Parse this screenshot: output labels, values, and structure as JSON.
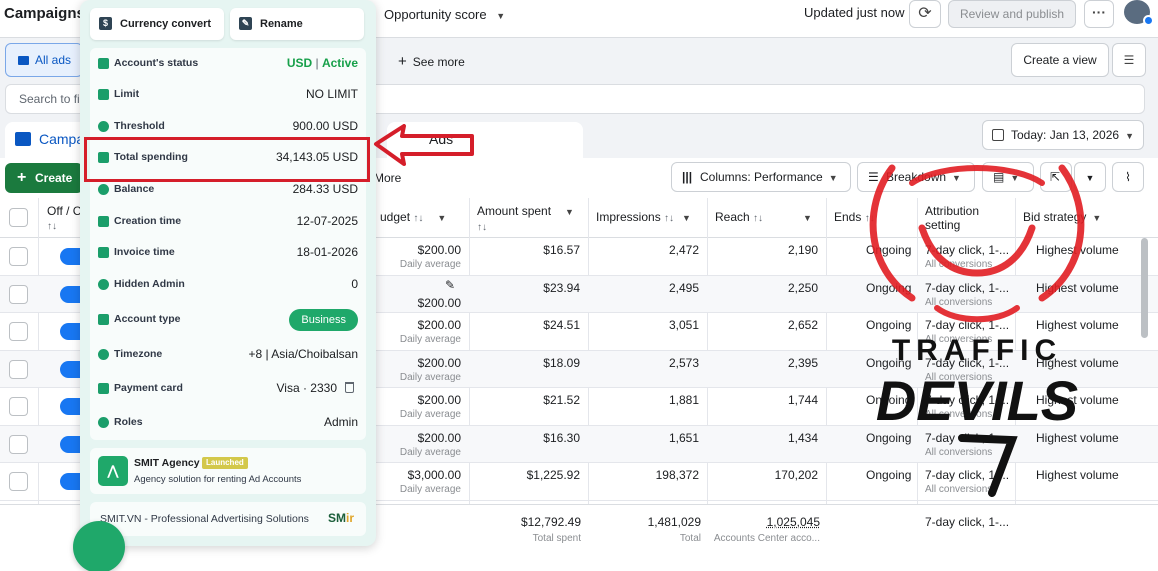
{
  "topbar": {
    "title": "Campaigns",
    "opportunity": "Opportunity score",
    "updated": "Updated just now",
    "review": "Review and publish",
    "more": "···"
  },
  "row2": {
    "all_ads": "All ads",
    "see_more": "See more",
    "create_view": "Create a view"
  },
  "search": {
    "placeholder": "Search to fil"
  },
  "tabs": {
    "campaigns": "Campa",
    "ads": "Ads"
  },
  "date": "Today: Jan 13, 2026",
  "toolbar": {
    "create": "Create",
    "more": "More",
    "columns": "Columns: Performance",
    "breakdown": "Breakdown"
  },
  "table": {
    "headers": {
      "off_on": "Off / C",
      "budget": "udget",
      "amount_spent": "Amount spent",
      "impressions": "Impressions",
      "reach": "Reach",
      "ends": "Ends",
      "attribution_1": "Attribution",
      "attribution_2": "setting",
      "bid_strategy": "Bid strategy"
    },
    "rows": [
      {
        "budget": "$200.00",
        "budget_sub": "Daily average",
        "spent": "$16.57",
        "impr": "2,472",
        "reach": "2,190",
        "ends": "Ongoing",
        "attr": "7-day click, 1-...",
        "attr_sub": "All conversions",
        "bid": "Highest volume"
      },
      {
        "budget": "$200.00",
        "budget_sub": "",
        "spent": "$23.94",
        "impr": "2,495",
        "reach": "2,250",
        "ends": "Ongoing",
        "attr": "7-day click, 1-...",
        "attr_sub": "All conversions",
        "bid": "Highest volume"
      },
      {
        "budget": "$200.00",
        "budget_sub": "Daily average",
        "spent": "$24.51",
        "impr": "3,051",
        "reach": "2,652",
        "ends": "Ongoing",
        "attr": "7-day click, 1-...",
        "attr_sub": "All conversions",
        "bid": "Highest volume"
      },
      {
        "budget": "$200.00",
        "budget_sub": "Daily average",
        "spent": "$18.09",
        "impr": "2,573",
        "reach": "2,395",
        "ends": "Ongoing",
        "attr": "7-day click, 1-...",
        "attr_sub": "All conversions",
        "bid": "Highest volume"
      },
      {
        "budget": "$200.00",
        "budget_sub": "Daily average",
        "spent": "$21.52",
        "impr": "1,881",
        "reach": "1,744",
        "ends": "Ongoing",
        "attr": "7-day click, 1-...",
        "attr_sub": "All conversions",
        "bid": "Highest volume"
      },
      {
        "budget": "$200.00",
        "budget_sub": "Daily average",
        "spent": "$16.30",
        "impr": "1,651",
        "reach": "1,434",
        "ends": "Ongoing",
        "attr": "7-day click, 1-...",
        "attr_sub": "All conversions",
        "bid": "Highest volume"
      },
      {
        "budget": "$3,000.00",
        "budget_sub": "Daily average",
        "spent": "$1,225.92",
        "impr": "198,372",
        "reach": "170,202",
        "ends": "Ongoing",
        "attr": "7-day click, 1-...",
        "attr_sub": "All conversions",
        "bid": "Highest volume"
      }
    ],
    "footer": {
      "spent": "$12,792.49",
      "spent_sub": "Total spent",
      "impr": "1,481,029",
      "impr_sub": "Total",
      "reach": "1,025,045",
      "reach_sub": "Accounts Center acco...",
      "attr": "7-day click, 1-..."
    }
  },
  "panel": {
    "currency_convert": "Currency convert",
    "rename": "Rename",
    "rows": {
      "status_label": "Account's status",
      "status_currency": "USD",
      "status_sep": " | ",
      "status_value": "Active",
      "limit_label": "Limit",
      "limit_value": "NO LIMIT",
      "threshold_label": "Threshold",
      "threshold_value": "900.00 USD",
      "spending_label": "Total spending",
      "spending_value": "34,143.05 USD",
      "balance_label": "Balance",
      "balance_value": "284.33 USD",
      "creation_label": "Creation time",
      "creation_value": "12-07-2025",
      "invoice_label": "Invoice time",
      "invoice_value": "18-01-2026",
      "hidden_label": "Hidden Admin",
      "hidden_value": "0",
      "type_label": "Account type",
      "type_value": "Business",
      "tz_label": "Timezone",
      "tz_value": "+8 | Asia/Choibalsan",
      "card_label": "Payment card",
      "card_value": "Visa · 2330",
      "roles_label": "Roles",
      "roles_value": "Admin"
    },
    "agency_title": "SMIT Agency",
    "agency_badge": "Launched",
    "agency_desc": "Agency solution for renting Ad Accounts",
    "footer_text": "SMIT.VN - Professional Advertising Solutions",
    "footer_logo_a": "SM",
    "footer_logo_b": "ir"
  },
  "watermark": {
    "line1": "TRAFFIC",
    "line2": "DEVILS"
  },
  "colors": {
    "highlight": "#d51e2a",
    "accent": "#1877f2",
    "panel_green": "#1fa86a"
  }
}
